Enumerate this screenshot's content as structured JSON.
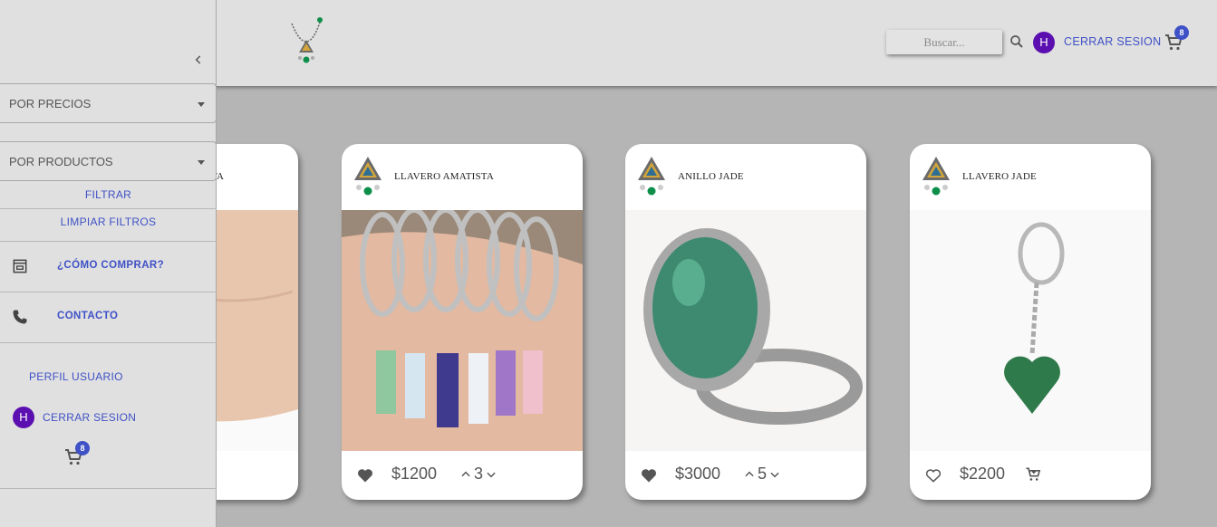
{
  "header": {
    "search_placeholder": "Buscar...",
    "user_initial": "H",
    "logout_label": "CERRAR SESION",
    "cart_count": "8"
  },
  "sidebar": {
    "filter_prices": "POR PRECIOS",
    "filter_products": "POR PRODUCTOS",
    "apply_filters": "FILTRAR",
    "clear_filters": "LIMPIAR FILTROS",
    "how_to_buy": "¿CÓMO COMPRAR?",
    "contact": "CONTACTO",
    "profile": "PERFIL USUARIO",
    "user_initial": "H",
    "logout_label": "CERRAR SESION",
    "cart_count": "8"
  },
  "products": [
    {
      "title": "TA",
      "price": "",
      "qty": ""
    },
    {
      "title": "LLAVERO AMATISTA",
      "price": "$1200",
      "qty": "3",
      "liked": true
    },
    {
      "title": "ANILLO JADE",
      "price": "$3000",
      "qty": "5",
      "liked": true
    },
    {
      "title": "LLAVERO JADE",
      "price": "$2200",
      "qty": "",
      "liked": false
    }
  ],
  "colors": {
    "accent": "#3f51c6",
    "avatar": "#5b0fb0",
    "jade": "#0d8f4a"
  }
}
